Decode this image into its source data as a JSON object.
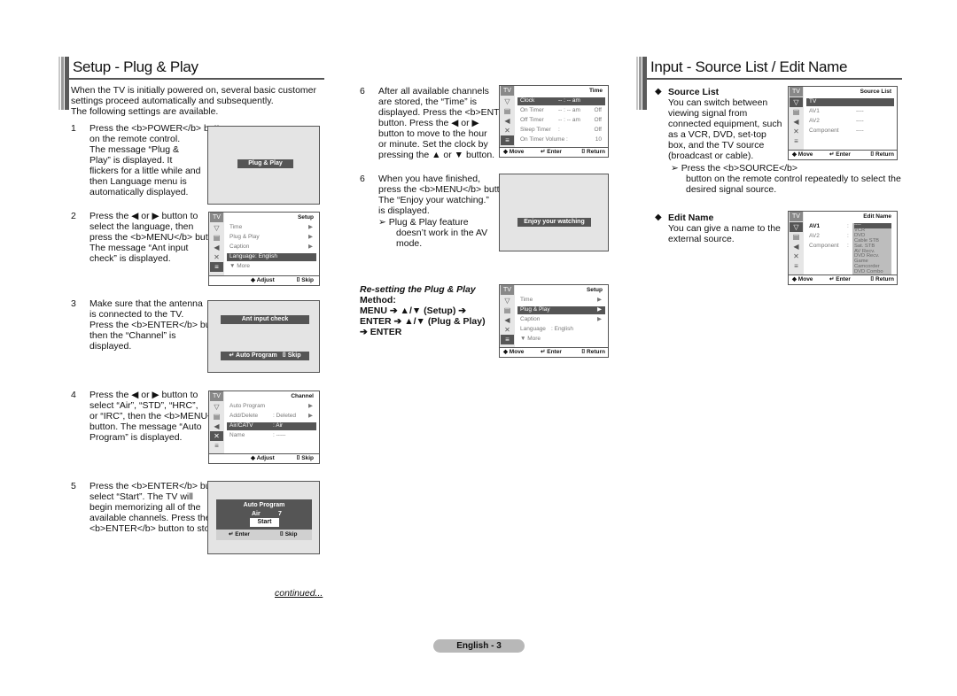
{
  "left_section": {
    "title": "Setup - Plug & Play",
    "intro_1": "When the TV is initially powered on, several basic customer",
    "intro_2": "settings proceed automatically and subsequently.",
    "intro_3": "The following settings are available.",
    "steps": [
      {
        "num": "1",
        "lines": [
          "Press the <b>POWER</b> button",
          "on the remote control.",
          "The message “Plug &",
          "Play” is displayed. It",
          "flickers for a little while and",
          "then Language menu is",
          "automatically displayed."
        ]
      },
      {
        "num": "2",
        "lines": [
          "Press the ◀ or ▶ button to",
          "select the language, then",
          "press the <b>MENU</b> button.",
          "The message “Ant input",
          "check” is displayed."
        ]
      },
      {
        "num": "3",
        "lines": [
          "Make sure that the antenna",
          "is connected to the TV.",
          "Press the <b>ENTER</b> button,",
          "then the “Channel” is",
          "displayed."
        ]
      },
      {
        "num": "4",
        "lines": [
          "Press the ◀ or ▶ button to",
          "select “Air”, “STD”, “HRC”,",
          "or “IRC”, then the <b>MENU</b>",
          "button. The message “Auto",
          "Program” is displayed."
        ]
      },
      {
        "num": "5",
        "lines": [
          "Press the <b>ENTER</b> button to",
          "select “Start”. The TV will",
          "begin memorizing all of the",
          "available channels. Press the",
          "<b>ENTER</b> button to stop."
        ]
      }
    ],
    "screen_plug_play": "Plug & Play",
    "setup_menu_1": {
      "tv": "TV",
      "title": "Setup",
      "rows": [
        {
          "label": "Time",
          "value": "",
          "arrow": "▶"
        },
        {
          "label": "Plug & Play",
          "value": "",
          "arrow": "▶"
        },
        {
          "label": "Caption",
          "value": "",
          "arrow": "▶"
        },
        {
          "label": "Language",
          "value": ": English",
          "arrow": ""
        },
        {
          "label": "▼ More",
          "value": "",
          "arrow": ""
        }
      ],
      "foot_left": "◆ Adjust",
      "foot_right": "⌷ Skip"
    },
    "screen_ant": {
      "message": "Ant input check",
      "foot_left": "↵ Auto Program",
      "foot_right": "⌷ Skip"
    },
    "channel_menu": {
      "tv": "TV",
      "title": "Channel",
      "rows": [
        {
          "label": "Auto Program",
          "value": "",
          "arrow": "▶"
        },
        {
          "label": "Add/Delete",
          "value": ": Deleted",
          "arrow": "▶"
        },
        {
          "label": "Air/CATV",
          "value": ": Air",
          "arrow": ""
        },
        {
          "label": "Name",
          "value": ": -----",
          "arrow": ""
        }
      ],
      "foot_left": "◆ Adjust",
      "foot_right": "⌷ Skip"
    },
    "auto_program": {
      "title": "Auto Program",
      "source": "Air",
      "channel": "7",
      "button": "Start",
      "foot_left": "↵ Enter",
      "foot_right": "⌷ Skip"
    },
    "continued": "continued..."
  },
  "middle_section": {
    "step6a": {
      "num": "6",
      "lines": [
        "After all available channels",
        "are stored, the “Time” is",
        "displayed. Press the <b>ENTER</b>",
        "button. Press the ◀ or ▶",
        "button to move to the hour",
        "or minute. Set the clock by",
        "pressing the ▲ or ▼ button."
      ]
    },
    "step6b": {
      "num": "6",
      "lines": [
        "When you have finished,",
        "press the <b>MENU</b> button.",
        "The “Enjoy your watching.”",
        "is displayed."
      ]
    },
    "note": [
      "➢ Plug & Play feature",
      "doesn’t work in the AV",
      "mode."
    ],
    "time_menu": {
      "tv": "TV",
      "title": "Time",
      "rows": [
        {
          "label": "Clock",
          "value": "-- : --  am",
          "end": ""
        },
        {
          "label": "On Timer",
          "value": "-- : --  am",
          "end": "Off"
        },
        {
          "label": "Off Timer",
          "value": "-- : --  am",
          "end": "Off"
        },
        {
          "label": "Sleep Timer",
          "value": ":",
          "end": "Off"
        },
        {
          "label": "On Timer Volume :",
          "value": "",
          "end": "10"
        }
      ],
      "foot_left": "◆ Move",
      "foot_mid": "↵ Enter",
      "foot_right": "⌷ Return"
    },
    "screen_enjoy": "Enjoy your watching",
    "reset_title": "Re-setting the Plug & Play",
    "reset_lines": [
      "Method:",
      "MENU ➔ ▲/▼ (Setup) ➔",
      "ENTER ➔ ▲/▼ (Plug & Play)",
      "➔ ENTER"
    ],
    "setup_menu_2": {
      "tv": "TV",
      "title": "Setup",
      "rows": [
        {
          "label": "Time",
          "value": "",
          "arrow": "▶"
        },
        {
          "label": "Plug & Play",
          "value": "",
          "arrow": "▶"
        },
        {
          "label": "Caption",
          "value": "",
          "arrow": "▶"
        },
        {
          "label": "Language",
          "value": ": English",
          "arrow": ""
        },
        {
          "label": "▼ More",
          "value": "",
          "arrow": ""
        }
      ],
      "foot_left": "◆ Move",
      "foot_mid": "↵ Enter",
      "foot_right": "⌷ Return"
    }
  },
  "right_section": {
    "title": "Input - Source List / Edit Name",
    "source_list": {
      "heading": "Source List",
      "lines": [
        "You can switch between",
        "viewing signal from",
        "connected equipment, such",
        "as a VCR, DVD, set-top",
        "box, and the TV source",
        "(broadcast or cable)."
      ],
      "note_1": "➢ Press the <b>SOURCE</b>",
      "note_2": "button on the remote control repeatedly to select the",
      "note_3": "desired signal source."
    },
    "source_menu": {
      "tv": "TV",
      "title": "Source List",
      "rows": [
        {
          "label": "TV",
          "value": ""
        },
        {
          "label": "AV1",
          "value": "----"
        },
        {
          "label": "AV2",
          "value": "----"
        },
        {
          "label": "Component",
          "value": "----"
        }
      ],
      "foot_left": "◆ Move",
      "foot_mid": "↵ Enter",
      "foot_right": "⌷ Return"
    },
    "edit_name": {
      "heading": "Edit Name",
      "lines": [
        "You can give a name to the",
        "external source."
      ]
    },
    "edit_menu": {
      "tv": "TV",
      "title": "Edit Name",
      "rows": [
        {
          "label": "AV1",
          "value": ":"
        },
        {
          "label": "AV2",
          "value": ":"
        },
        {
          "label": "Component",
          "value": ":"
        }
      ],
      "options": [
        "----",
        "VCR",
        "DVD",
        "Cable STB",
        "Sat. STB",
        "AV Recv.",
        "DVD Recv.",
        "Game",
        "Camcorder",
        "DVD Combo"
      ],
      "foot_left": "◆ Move",
      "foot_mid": "↵ Enter",
      "foot_right": "⌷ Return"
    }
  },
  "footer": {
    "page_label": "English - 3"
  }
}
